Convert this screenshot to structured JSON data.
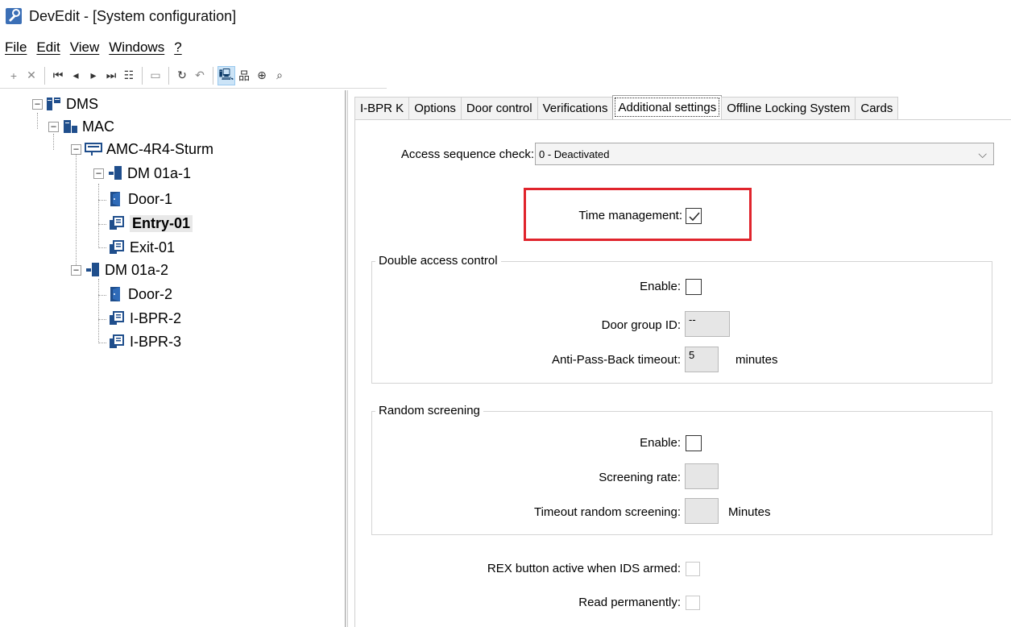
{
  "window": {
    "title": "DevEdit - [System configuration]"
  },
  "menu": [
    {
      "label": "File"
    },
    {
      "label": "Edit"
    },
    {
      "label": "View"
    },
    {
      "label": "Windows"
    },
    {
      "label": "?"
    }
  ],
  "tree": {
    "nodes": [
      {
        "label": "DMS",
        "icon": "server-icon"
      },
      {
        "label": "MAC",
        "icon": "controller-icon"
      },
      {
        "label": "AMC-4R4-Sturm",
        "icon": "access-controller-icon"
      },
      {
        "label": "DM 01a-1",
        "icon": "door-module-icon"
      },
      {
        "label": "Door-1",
        "icon": "door-icon"
      },
      {
        "label": "Entry-01",
        "icon": "card-reader-icon"
      },
      {
        "label": "Exit-01",
        "icon": "card-reader-icon"
      },
      {
        "label": "DM 01a-2",
        "icon": "door-module-icon"
      },
      {
        "label": "Door-2",
        "icon": "door-icon"
      },
      {
        "label": "I-BPR-2",
        "icon": "card-reader-icon"
      },
      {
        "label": "I-BPR-3",
        "icon": "card-reader-icon"
      }
    ],
    "selected": "Entry-01"
  },
  "tabs": [
    {
      "label": "I-BPR K"
    },
    {
      "label": "Options"
    },
    {
      "label": "Door control"
    },
    {
      "label": "Verifications"
    },
    {
      "label": "Additional settings"
    },
    {
      "label": "Offline Locking System"
    },
    {
      "label": "Cards"
    }
  ],
  "active_tab": "Additional settings",
  "settings": {
    "access_sequence_label": "Access sequence check:",
    "access_sequence_value": "0 - Deactivated",
    "time_management_label": "Time management:",
    "time_management_checked": true,
    "double_access": {
      "title": "Double access control",
      "enable_label": "Enable:",
      "door_group_label": "Door group ID:",
      "door_group_value": "--",
      "apb_label": "Anti-Pass-Back timeout:",
      "apb_value": "5",
      "apb_unit": "minutes"
    },
    "random_screening": {
      "title": "Random screening",
      "enable_label": "Enable:",
      "rate_label": "Screening rate:",
      "timeout_label": "Timeout random screening:",
      "timeout_unit": "Minutes"
    },
    "rex_label": "REX button active when IDS armed:",
    "read_perm_label": "Read permanently:"
  },
  "colors": {
    "highlight": "#e0242c",
    "icon_blue": "#1f4e8c"
  }
}
